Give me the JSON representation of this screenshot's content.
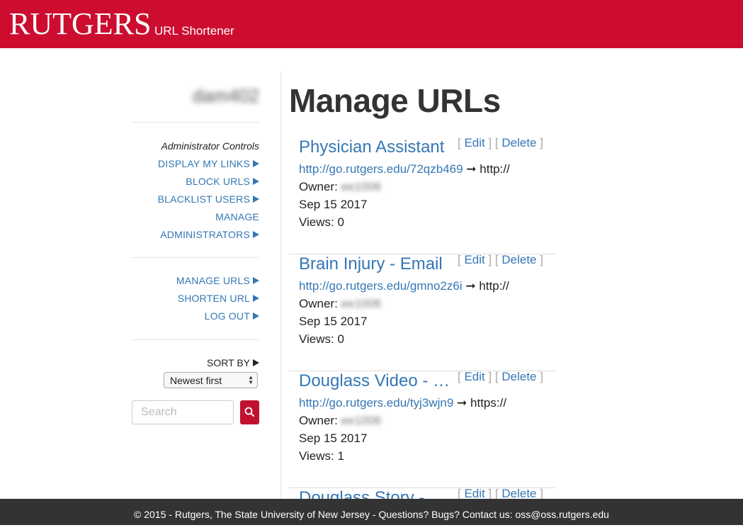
{
  "header": {
    "logo": "RUTGERS",
    "app_title": "URL Shortener",
    "brand_color": "#cc0d2f"
  },
  "sidebar": {
    "username": "dam402",
    "admin_heading": "Administrator Controls",
    "admin_items": [
      {
        "label": "DISPLAY MY LINKS",
        "arrow": true
      },
      {
        "label": "BLOCK URLS",
        "arrow": true
      },
      {
        "label": "BLACKLIST USERS",
        "arrow": true
      },
      {
        "label": "MANAGE",
        "arrow": false
      },
      {
        "label": "ADMINISTRATORS",
        "arrow": true
      }
    ],
    "user_items": [
      {
        "label": "MANAGE URLS"
      },
      {
        "label": "SHORTEN URL"
      },
      {
        "label": "LOG OUT"
      }
    ],
    "sort_label": "SORT BY",
    "sort_value": "Newest first",
    "search_placeholder": "Search"
  },
  "main": {
    "title": "Manage URLs",
    "edit_label": "Edit",
    "delete_label": "Delete",
    "owner_label": "Owner:",
    "views_label": "Views:",
    "arrow": "➞",
    "urls": [
      {
        "title": "Physician Assistant",
        "short": "http://go.rutgers.edu/72qzb469",
        "target": "http://",
        "owner": "ee1006",
        "date": "Sep 15 2017",
        "views": "0"
      },
      {
        "title": "Brain Injury - Email",
        "short": "http://go.rutgers.edu/gmno2z6i",
        "target": "http://",
        "owner": "ee1006",
        "date": "Sep 15 2017",
        "views": "0"
      },
      {
        "title": "Douglass Video - Email",
        "short": "http://go.rutgers.edu/tyj3wjn9",
        "target": "https://",
        "owner": "ee1006",
        "date": "Sep 15 2017",
        "views": "1"
      },
      {
        "title": "Douglass Story - Email",
        "short": "",
        "target": "",
        "owner": "",
        "date": "",
        "views": ""
      }
    ]
  },
  "footer": {
    "text": "© 2015 - Rutgers, The State University of New Jersey - Questions? Bugs? Contact us: oss@oss.rutgers.edu"
  }
}
